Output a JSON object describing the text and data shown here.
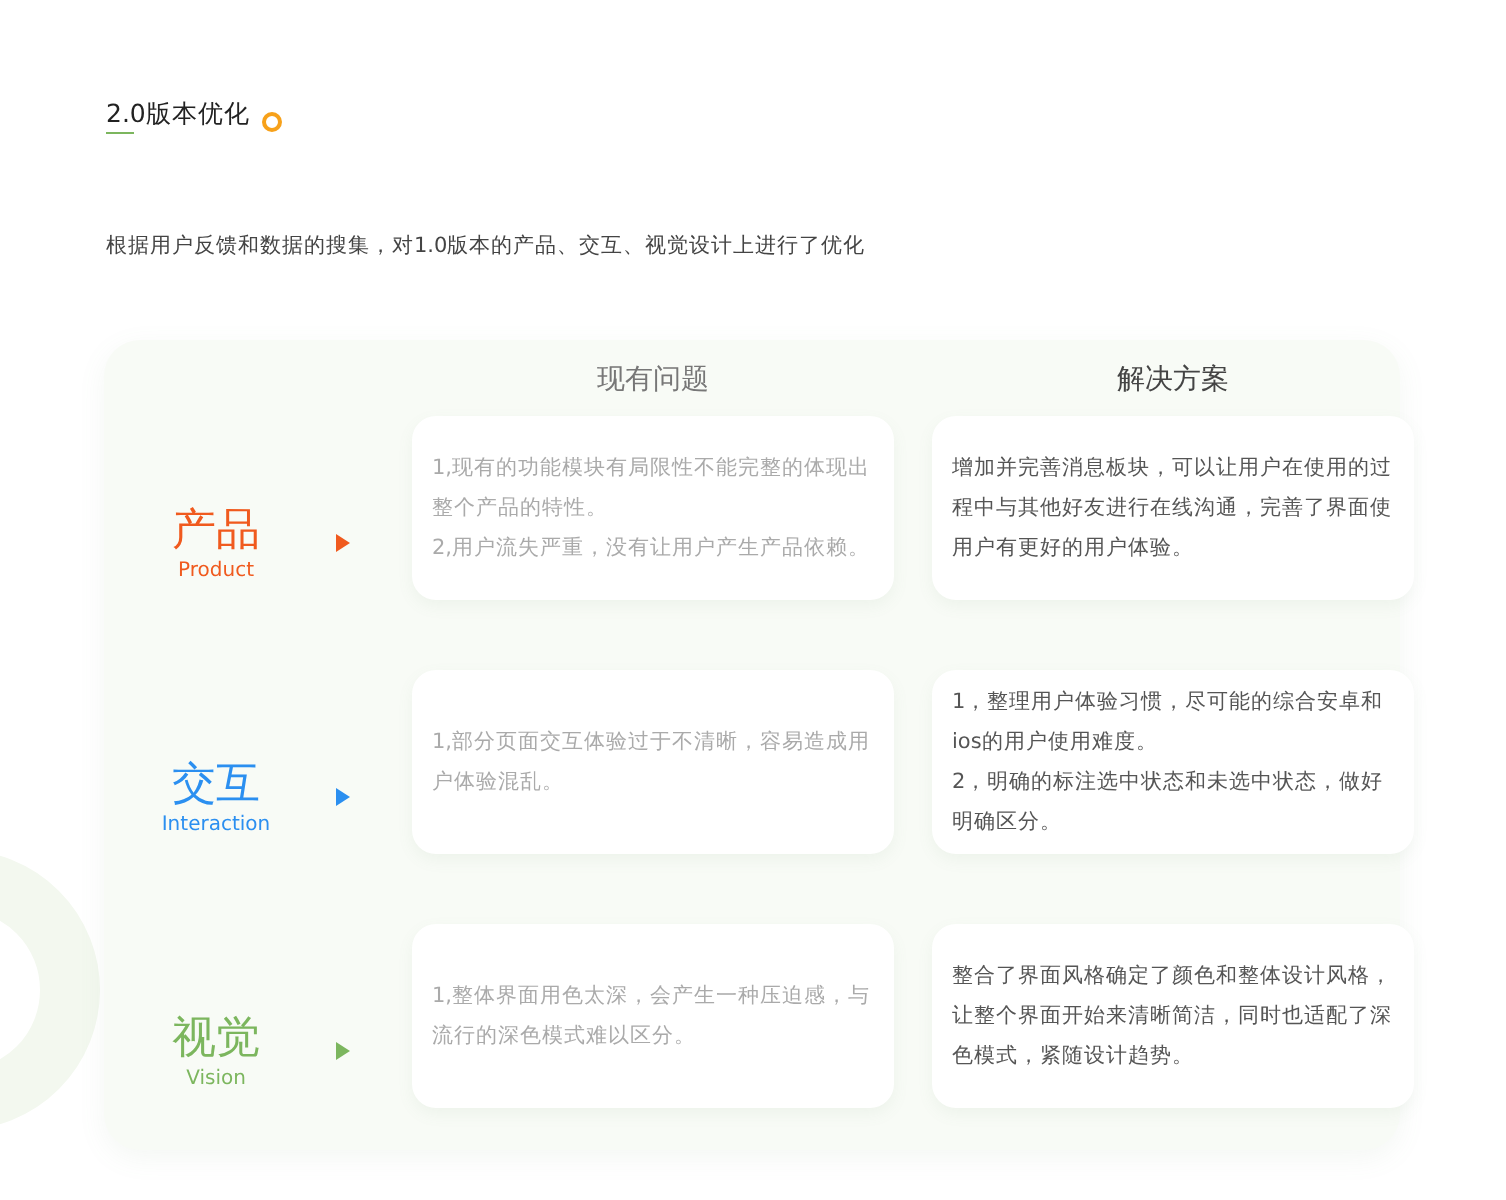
{
  "section_title": "2.0版本优化",
  "intro": "根据用户反馈和数据的搜集，对1.0版本的产品、交互、视觉设计上进行了优化",
  "columns": [
    "现有问题",
    "解决方案"
  ],
  "rows": [
    {
      "name": "产品",
      "subtitle": "Product",
      "color": "#f05a1e",
      "issues": [
        "1,现有的功能模块有局限性不能完整的体现出整个产品的特性。",
        "2,用户流失严重，没有让用户产生产品依赖。"
      ],
      "solutions": [
        "增加并完善消息板块，可以让用户在使用的过程中与其他好友进行在线沟通，完善了界面使用户有更好的用户体验。"
      ]
    },
    {
      "name": "交互",
      "subtitle": "Interaction",
      "color": "#2b8ff0",
      "issues": [
        "1,部分页面交互体验过于不清晰，容易造成用户体验混乱。"
      ],
      "solutions": [
        "1，整理用户体验习惯，尽可能的综合安卓和ios的用户使用难度。",
        "2，明确的标注选中状态和未选中状态，做好明确区分。"
      ]
    },
    {
      "name": "视觉",
      "subtitle": "Vision",
      "color": "#7cb65e",
      "issues": [
        "1,整体界面用色太深，会产生一种压迫感，与流行的深色模式难以区分。"
      ],
      "solutions": [
        "整合了界面风格确定了颜色和整体设计风格，让整个界面开始来清晰简洁，同时也适配了深色模式，紧随设计趋势。"
      ]
    }
  ]
}
